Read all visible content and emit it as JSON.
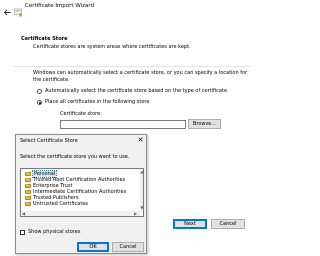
{
  "wizard": {
    "title": "Certificate Import Wizard",
    "section_heading": "Certificate Store",
    "section_description": "Certificate stores are system areas where certificates are kept.",
    "auto_text_line1": "Windows can automatically select a certificate store, or you can specify a location for",
    "auto_text_line2": "the certificate.",
    "radio_auto_label": "Automatically select the certificate store based on the type of certificate",
    "radio_place_label": "Place all certificates in the following store",
    "cert_store_label": "Certificate store:",
    "cert_store_value": "",
    "browse_label": "Browse...",
    "next_label": "Next",
    "cancel_label": "Cancel",
    "selected_option": "place"
  },
  "dialog": {
    "title": "Select Certificate Store",
    "close_glyph": "✕",
    "instruction": "Select the certificate store you want to use.",
    "stores": [
      "Personal",
      "Trusted Root Certification Authorities",
      "Enterprise Trust",
      "Intermediate Certification Authorities",
      "Trusted Publishers",
      "Untrusted Certificates"
    ],
    "selected_store": "Personal",
    "show_physical_label": "Show physical stores",
    "show_physical_checked": false,
    "ok_label": "OK",
    "cancel_label": "Cancel"
  },
  "icons": {
    "back": "back-arrow-icon",
    "wizard": "certificate-icon",
    "folder": "folder-icon"
  },
  "colors": {
    "accent": "#0078d7",
    "selection": "#cce8ff",
    "folder": "#e8b84a"
  }
}
